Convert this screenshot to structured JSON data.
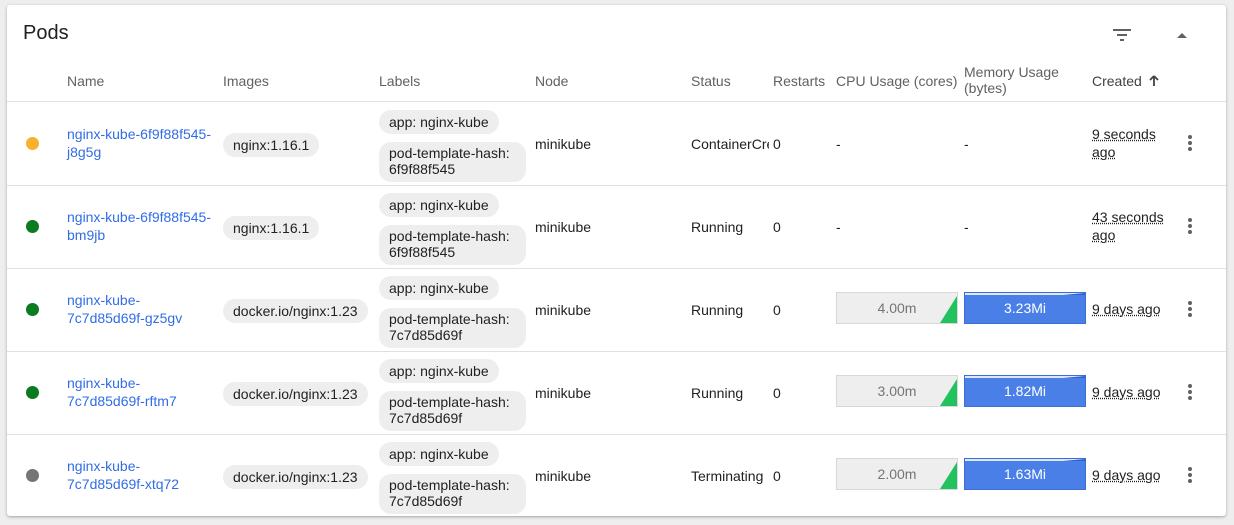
{
  "title": "Pods",
  "columns": {
    "name": "Name",
    "images": "Images",
    "labels": "Labels",
    "node": "Node",
    "status": "Status",
    "restarts": "Restarts",
    "cpu": "CPU Usage (cores)",
    "memory_line1": "Memory Usage",
    "memory_line2": "(bytes)",
    "created": "Created"
  },
  "colors": {
    "pending": "#f9b02c",
    "running": "#0a7b1e",
    "terminating": "#757575",
    "link": "#326de6",
    "cpu_fill": "#22c35e",
    "memory_fill": "#4a7fe8"
  },
  "icons": {
    "filter": "filter-icon",
    "collapse": "chevron-up-icon",
    "sort": "arrow-up-icon",
    "more": "more-vert-icon"
  },
  "rows": [
    {
      "name_line1": "nginx-kube-6f9f88f545-",
      "name_line2": "j8g5g",
      "image": "nginx:1.16.1",
      "label1": "app: nginx-kube",
      "label2": "pod-template-hash: 6f9f88f545",
      "node": "minikube",
      "status": "ContainerCreating",
      "restarts": "0",
      "cpu": "-",
      "memory": "-",
      "created_line1": "9 seconds",
      "created_line2": "ago",
      "state": "pending"
    },
    {
      "name_line1": "nginx-kube-6f9f88f545-",
      "name_line2": "bm9jb",
      "image": "nginx:1.16.1",
      "label1": "app: nginx-kube",
      "label2": "pod-template-hash: 6f9f88f545",
      "node": "minikube",
      "status": "Running",
      "restarts": "0",
      "cpu": "-",
      "memory": "-",
      "created_line1": "43 seconds",
      "created_line2": "ago",
      "state": "running"
    },
    {
      "name_line1": "nginx-kube-",
      "name_line2": "7c7d85d69f-gz5gv",
      "image": "docker.io/nginx:1.23",
      "label1": "app: nginx-kube",
      "label2": "pod-template-hash: 7c7d85d69f",
      "node": "minikube",
      "status": "Running",
      "restarts": "0",
      "cpu": "4.00m",
      "memory": "3.23Mi",
      "created_line1": "9 days ago",
      "created_line2": "",
      "state": "running"
    },
    {
      "name_line1": "nginx-kube-",
      "name_line2": "7c7d85d69f-rftm7",
      "image": "docker.io/nginx:1.23",
      "label1": "app: nginx-kube",
      "label2": "pod-template-hash: 7c7d85d69f",
      "node": "minikube",
      "status": "Running",
      "restarts": "0",
      "cpu": "3.00m",
      "memory": "1.82Mi",
      "created_line1": "9 days ago",
      "created_line2": "",
      "state": "running"
    },
    {
      "name_line1": "nginx-kube-",
      "name_line2": "7c7d85d69f-xtq72",
      "image": "docker.io/nginx:1.23",
      "label1": "app: nginx-kube",
      "label2": "pod-template-hash: 7c7d85d69f",
      "node": "minikube",
      "status": "Terminating",
      "restarts": "0",
      "cpu": "2.00m",
      "memory": "1.63Mi",
      "created_line1": "9 days ago",
      "created_line2": "",
      "state": "terminating"
    }
  ]
}
